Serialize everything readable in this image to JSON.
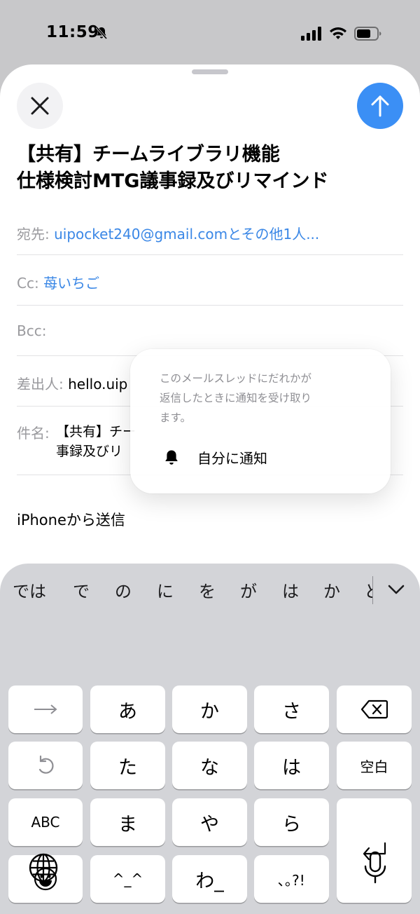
{
  "status_bar": {
    "time": "11:59"
  },
  "compose": {
    "title_lines": [
      "【共有】チームライブラリ機能",
      "仕様検討MTG議事録及びリマインド"
    ],
    "to_label": "宛先:",
    "to_value": "uipocket240@gmail.comとその他1人...",
    "cc_label": "Cc:",
    "cc_value": "苺いちご",
    "bcc_label": "Bcc:",
    "from_label": "差出人:",
    "from_value": "hello.uip",
    "subject_label": "件名:",
    "subject_lines": [
      "【共有】チー",
      "事録及びリ"
    ],
    "body": "iPhoneから送信"
  },
  "popover": {
    "description": "このメールスレッドにだれかが返信したときに通知を受け取ります。",
    "action_label": "自分に通知"
  },
  "keyboard": {
    "candidates": [
      "では",
      "で",
      "の",
      "に",
      "を",
      "が",
      "は",
      "か",
      "と"
    ],
    "keys": {
      "a": "あ",
      "ka": "か",
      "sa": "さ",
      "ta": "た",
      "na": "な",
      "ha": "は",
      "space": "空白",
      "abc": "ABC",
      "ma": "ま",
      "ya": "や",
      "ra": "ら",
      "kaomoji": "^_^",
      "wa": "わ_",
      "punct": "､｡?!"
    }
  },
  "icons": {
    "close": "close-icon",
    "send": "arrow-up-icon",
    "bell": "bell-icon",
    "notifications_off": "bell-slash-icon",
    "backspace": "delete-left-icon",
    "undo": "undo-icon",
    "return": "return-icon",
    "emoji": "emoji-icon",
    "globe": "globe-icon",
    "mic": "microphone-icon",
    "arrow": "arrow-right-icon",
    "chevron": "chevron-down-icon"
  },
  "colors": {
    "accent": "#3b8ff5",
    "link": "#3a87e6",
    "label_gray": "#9a9a9e",
    "keyboard_bg": "#d3d4d8"
  }
}
